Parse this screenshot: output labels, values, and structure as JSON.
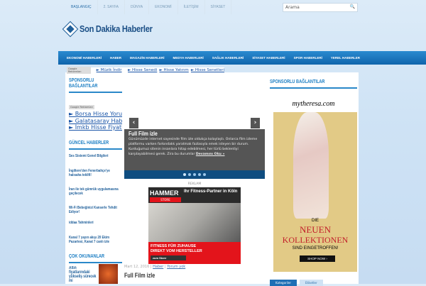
{
  "topnav": {
    "items": [
      "BAŞLANGIÇ",
      "2. SAYFA",
      "DÜNYA",
      "EKONOMİ",
      "İLETİŞİM",
      "SİYASET"
    ]
  },
  "search": {
    "placeholder": "Arama",
    "icon": "search-icon"
  },
  "logo": {
    "text": "Son Dakika Haberler"
  },
  "menu": {
    "items": [
      "EKONOMİ HABERLERİ",
      "HABER",
      "MAGAZİN HABERLERİ",
      "MEDYA HABERLERİ",
      "SAĞLIK HABERLERİ",
      "SİYASET HABERLERİ",
      "SPOR HABERLERİ",
      "YEREL HABERLER"
    ]
  },
  "adlinks": {
    "badge": "Google Reklamları",
    "links": [
      "► Müzik İndir",
      "► Hisse Senedi",
      "► Hisse Yatırım",
      "► Hisse Senetleri"
    ]
  },
  "left": {
    "sponsor_title": "SPONSORLU BAĞLANTILAR",
    "badge": "Google Reklamları",
    "links": [
      "► Borsa Hisse Yorumları",
      "► Galatasaray Haberleri",
      "► İmkb Hisse Fiyatları"
    ],
    "news_title": "GÜNCEL HABERLER",
    "news": [
      "Ses Sistemi Genel Bilgileri",
      "İngiltere'den Fenerbahçe'ye halısaha teklifi!",
      "İran ile tek gümrük uygulamasına geçilecek",
      "Wi-Fi Bebeğinizi Kanserle Tehdit Ediyor!",
      "iddaa Tahminleri",
      "Kanal 7 yayın akışı 20 Ekim Pazartesi, Kanal 7 canlı izle"
    ],
    "popular_title": "ÇOK OKUNANLAR",
    "popular": [
      "Altın fiyatlarındaki yükseliş sürecek mi"
    ]
  },
  "slider": {
    "title": "Full Film izle",
    "text": "Günümüzde internet sayesinde film izle oldukça kolaylaştı. Onlarca film izleme platformu varken farkındalık yaratmak fazlasıyla emek isteyen bir durum. Kurduğumuz sitenin insanlara hitap edebilmesi, her türlü beklentiyi karşılayabilmesi gerek. Zira bu durumlar",
    "more": "Devamını Oku »",
    "slides": 5,
    "active": 0
  },
  "ad": {
    "label": "REKLAM",
    "brand": "HAMMER",
    "store": "STORE",
    "headline": "Ihr Fitness-Partner in Köln",
    "line1": "FITNESS FÜR ZUHAUSE",
    "line2": "DIREKT VOM HERSTELLER",
    "cta": "zum Store"
  },
  "post": {
    "date": "Mart 12, 2016",
    "category": "Haber",
    "comments": "Yorum yok",
    "title": "Full Film izle"
  },
  "right": {
    "title": "SPONSORLU BAĞLANTILAR",
    "ad": {
      "brand": "mytheresa.com",
      "l1": "DIE",
      "l2": "NEUEN",
      "l3": "KOLLEKTIONEN",
      "l4": "SIND EINGETROFFEN!",
      "cta": "SHOP NOW ›"
    },
    "tabs": [
      "Kategoriler",
      "Etiketler"
    ]
  }
}
